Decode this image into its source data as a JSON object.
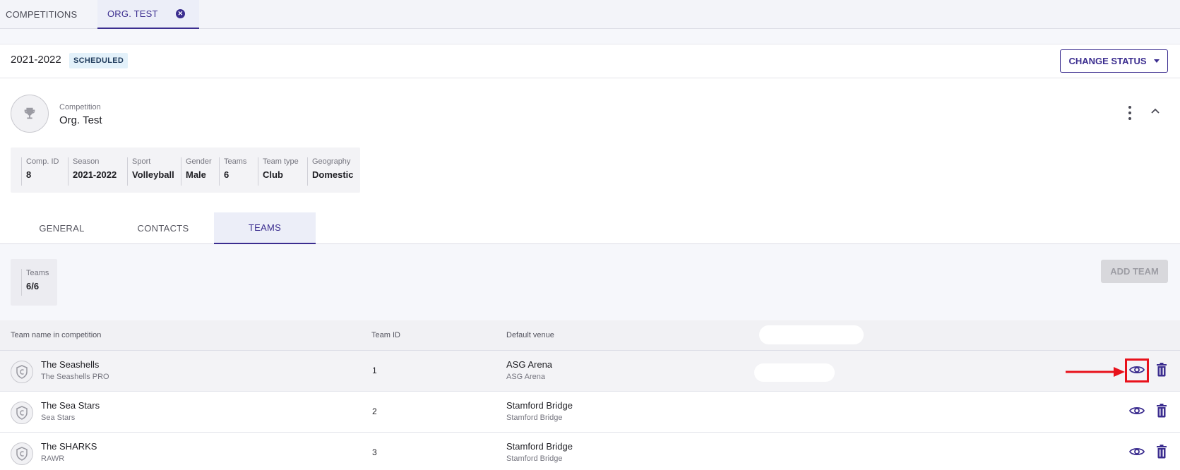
{
  "top_tabs": [
    {
      "label": "COMPETITIONS"
    },
    {
      "label": "ORG. TEST"
    }
  ],
  "season": {
    "label": "2021-2022",
    "badge": "SCHEDULED",
    "change_status_label": "CHANGE STATUS"
  },
  "competition": {
    "label": "Competition",
    "name": "Org. Test"
  },
  "info": [
    {
      "label": "Comp. ID",
      "value": "8"
    },
    {
      "label": "Season",
      "value": "2021-2022"
    },
    {
      "label": "Sport",
      "value": "Volleyball"
    },
    {
      "label": "Gender",
      "value": "Male"
    },
    {
      "label": "Teams",
      "value": "6"
    },
    {
      "label": "Team type",
      "value": "Club"
    },
    {
      "label": "Geography",
      "value": "Domestic"
    }
  ],
  "section_tabs": [
    {
      "label": "GENERAL"
    },
    {
      "label": "CONTACTS"
    },
    {
      "label": "TEAMS"
    }
  ],
  "teams_summary": {
    "label": "Teams",
    "value": "6/6",
    "add_label": "ADD TEAM"
  },
  "table": {
    "headers": [
      "Team name in competition",
      "Team ID",
      "Default venue"
    ],
    "rows": [
      {
        "name": "The Seashells",
        "sub": "The Seashells PRO",
        "id": "1",
        "venue": "ASG Arena",
        "venue_sub": "ASG Arena"
      },
      {
        "name": "The Sea Stars",
        "sub": "Sea Stars",
        "id": "2",
        "venue": "Stamford Bridge",
        "venue_sub": "Stamford Bridge"
      },
      {
        "name": "The SHARKS",
        "sub": "RAWR",
        "id": "3",
        "venue": "Stamford Bridge",
        "venue_sub": "Stamford Bridge"
      }
    ]
  },
  "icons": {
    "close": "close-circle-icon",
    "trophy": "trophy-icon",
    "team": "shield-icon",
    "view": "eye-icon",
    "delete": "trash-icon",
    "menu": "kebab-menu-icon",
    "collapse": "chevron-up-icon"
  },
  "colors": {
    "accent": "#3b2d8f",
    "highlight": "#e8111b"
  }
}
